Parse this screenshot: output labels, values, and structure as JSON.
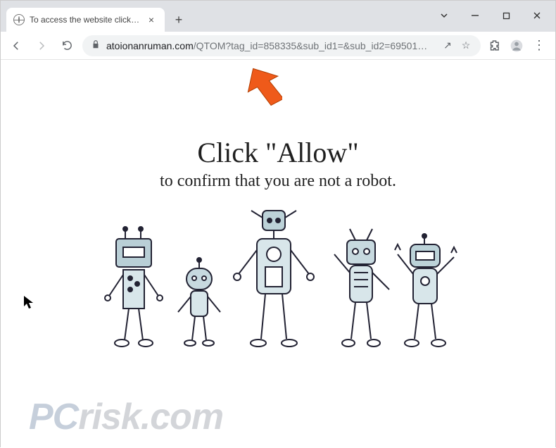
{
  "window": {
    "tab_title": "To access the website click the \"A",
    "minimize_tooltip": "Minimize",
    "maximize_tooltip": "Maximize",
    "close_tooltip": "Close",
    "caret_tooltip": "Search tabs"
  },
  "toolbar": {
    "back_tooltip": "Back",
    "forward_tooltip": "Forward",
    "reload_tooltip": "Reload",
    "url_host": "atoionanruman.com",
    "url_path": "/QTOM?tag_id=858335&sub_id1=&sub_id2=69501…",
    "share_tooltip": "Share",
    "bookmark_tooltip": "Bookmark",
    "extensions_tooltip": "Extensions",
    "profile_tooltip": "Profile",
    "menu_tooltip": "Customize and control"
  },
  "page": {
    "headline": "Click \"Allow\"",
    "subline": "to confirm that you are not a robot."
  },
  "watermark": {
    "pc": "PC",
    "risk": "risk.com"
  },
  "icons": {
    "close_glyph": "×",
    "plus_glyph": "+",
    "star_glyph": "☆",
    "menu_glyph": "⋮",
    "share_glyph": "↗"
  }
}
